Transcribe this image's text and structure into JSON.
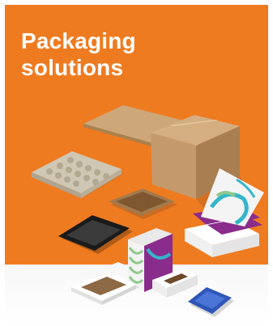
{
  "banner": {
    "headline_line1": "Packaging",
    "headline_line2": "solutions"
  },
  "colors": {
    "background_orange": "#ef7b20",
    "headline_text": "#ffffff",
    "cardboard": "#c49a6c",
    "pulp_tray": "#cfc6b3",
    "black_tray": "#1b1b1b",
    "blue_tray": "#2e56b8",
    "purple_accent": "#8a2c8c",
    "teal_accent": "#34b6c9"
  },
  "products": [
    "corrugated-sheet",
    "cardboard-box",
    "egg-tray",
    "kraft-tray",
    "black-plastic-tray",
    "printed-carton",
    "printed-gift-box",
    "white-mailer-box",
    "sleeve-insert",
    "blue-plastic-tray"
  ]
}
